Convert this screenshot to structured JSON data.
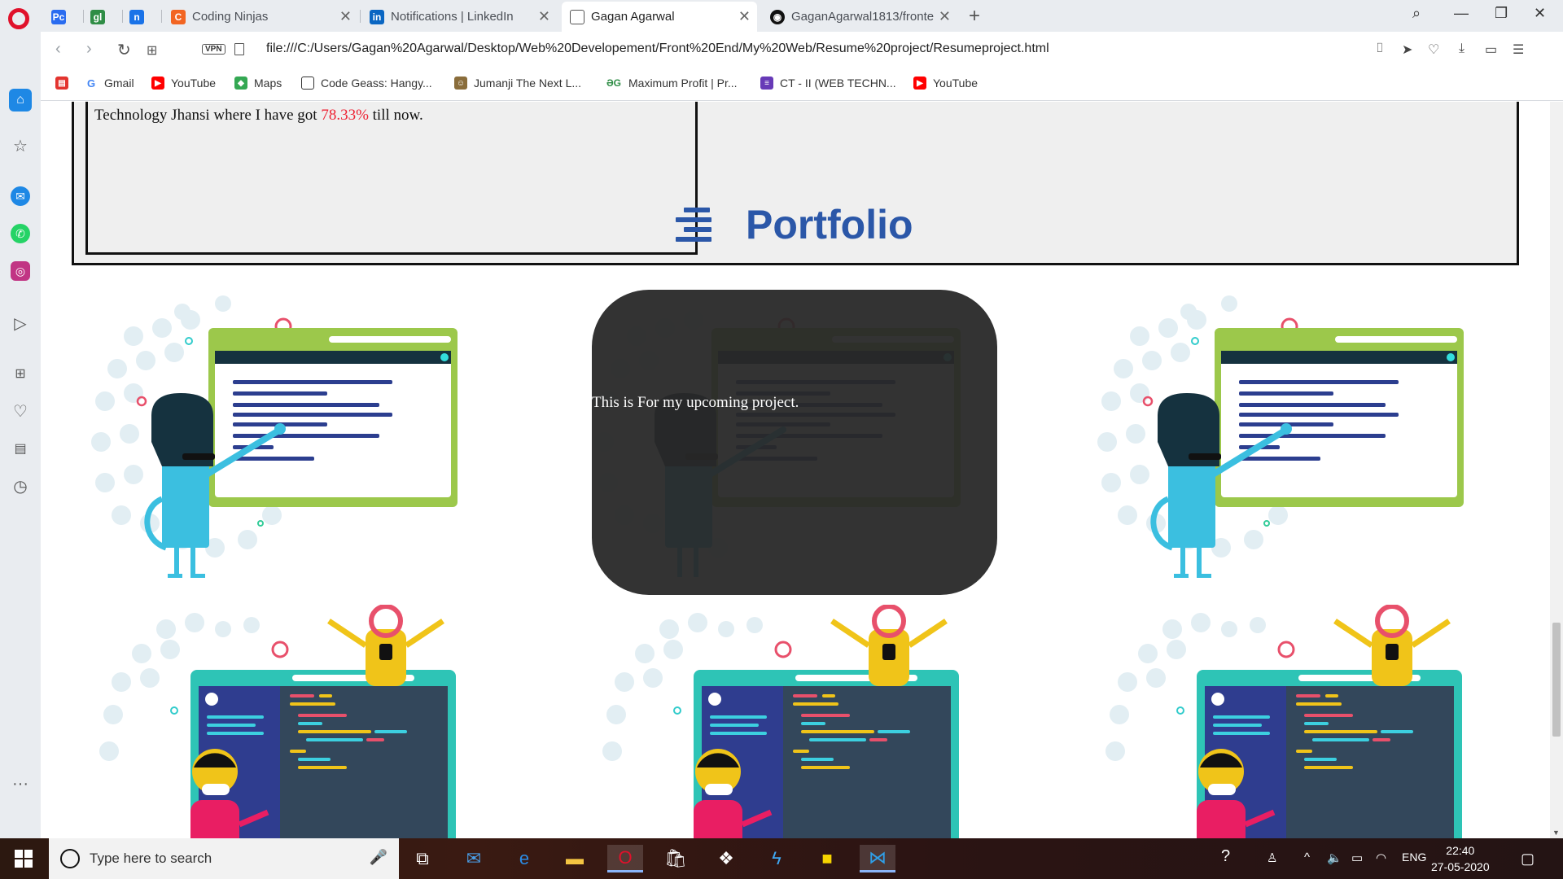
{
  "browser": {
    "tabs": [
      {
        "label": "",
        "icon": "pycharm-icon",
        "color": "#2a6cf0"
      },
      {
        "label": "",
        "icon": "gfg-icon",
        "color": "#2f8d46"
      },
      {
        "label": "",
        "icon": "n-icon",
        "color": "#1a73e8"
      },
      {
        "label": "Coding Ninjas",
        "icon": "coding-ninjas-icon",
        "color": "#f26522"
      },
      {
        "label": "Notifications | LinkedIn",
        "icon": "linkedin-icon",
        "color": "#0a66c2"
      },
      {
        "label": "Gagan Agarwal",
        "icon": "file-icon",
        "color": "#555555"
      },
      {
        "label": "GaganAgarwal1813/fronte",
        "icon": "github-icon",
        "color": "#111111"
      }
    ],
    "url": "file:///C:/Users/Gagan%20Agarwal/Desktop/Web%20Developement/Front%20End/My%20Web/Resume%20project/Resumeproject.html",
    "vpn_label": "VPN",
    "bookmarks": [
      {
        "label": "",
        "icon": "pdf-icon",
        "color": "#e3342f"
      },
      {
        "label": "Gmail",
        "icon": "google-icon",
        "color": "#4285f4"
      },
      {
        "label": "YouTube",
        "icon": "youtube-icon",
        "color": "#ff0000"
      },
      {
        "label": "Maps",
        "icon": "maps-icon",
        "color": "#34a853"
      },
      {
        "label": "Code Geass: Hangy...",
        "icon": "tv-icon",
        "color": "#333333"
      },
      {
        "label": "Jumanji The Next L...",
        "icon": "movie-icon",
        "color": "#8a6d3b"
      },
      {
        "label": "Maximum Profit | Pr...",
        "icon": "gfg-icon",
        "color": "#2f8d46"
      },
      {
        "label": "CT - II (WEB TECHN...",
        "icon": "forms-icon",
        "color": "#673ab7"
      },
      {
        "label": "YouTube",
        "icon": "youtube-icon",
        "color": "#ff0000"
      }
    ]
  },
  "page": {
    "education_text_pre": "Technology Jhansi where I have got ",
    "education_text_value": "78.33%",
    "education_text_post": " till now.",
    "portfolio_title": "Portfolio",
    "hover_caption": "This is For my upcoming project."
  },
  "taskbar": {
    "search_placeholder": "Type here to search",
    "language": "ENG",
    "time": "22:40",
    "date": "27-05-2020"
  },
  "colors": {
    "accent": "#2b57a8",
    "opera_red": "#e0112b"
  }
}
